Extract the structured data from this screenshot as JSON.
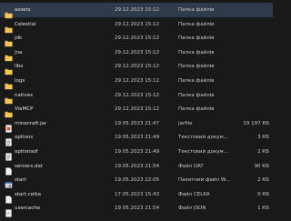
{
  "files": [
    {
      "name": "assets",
      "date": "29.12.2023 15:12",
      "type": "Папка файлів",
      "size": "",
      "icon": "folder-icon"
    },
    {
      "name": "Celestial",
      "date": "29.12.2023 15:12",
      "type": "Папка файлів",
      "size": "",
      "icon": "folder-icon"
    },
    {
      "name": "jdk",
      "date": "29.12.2023 15:12",
      "type": "Папка файлів",
      "size": "",
      "icon": "folder-icon"
    },
    {
      "name": "jna",
      "date": "29.12.2023 15:12",
      "type": "Папка файлів",
      "size": "",
      "icon": "folder-icon"
    },
    {
      "name": "libs",
      "date": "29.12.2023 15:12",
      "type": "Папка файлів",
      "size": "",
      "icon": "folder-icon"
    },
    {
      "name": "logs",
      "date": "29.12.2023 15:12",
      "type": "Папка файлів",
      "size": "",
      "icon": "folder-icon"
    },
    {
      "name": "natives",
      "date": "29.12.2023 15:12",
      "type": "Папка файлів",
      "size": "",
      "icon": "folder-icon"
    },
    {
      "name": "ViaMCP",
      "date": "29.12.2023 15:12",
      "type": "Папка файлів",
      "size": "",
      "icon": "folder-icon"
    },
    {
      "name": "minecraft.jar",
      "date": "19.05.2023 21:47",
      "type": "jarfile",
      "size": "19 197 КБ",
      "icon": "jar-file-icon"
    },
    {
      "name": "options",
      "date": "19.05.2023 21:49",
      "type": "Текстовий докум...",
      "size": "3 КБ",
      "icon": "text-file-icon"
    },
    {
      "name": "optionsof",
      "date": "19.05.2023 21:49",
      "type": "Текстовий докум...",
      "size": "2 КБ",
      "icon": "text-file-icon"
    },
    {
      "name": "servers.dat",
      "date": "19.05.2023 21:54",
      "type": "Файл DAT",
      "size": "90 КБ",
      "icon": "dat-file-icon"
    },
    {
      "name": "start",
      "date": "19.05.2023 22:05",
      "type": "Пакетний файл W...",
      "size": "2 КБ",
      "icon": "batch-file-icon"
    },
    {
      "name": "start.celka",
      "date": "17.05.2023 15:43",
      "type": "Файл CELKA",
      "size": "0 КБ",
      "icon": "file-icon"
    },
    {
      "name": "usercache",
      "date": "19.05.2023 21:54",
      "type": "Файл JSON",
      "size": "1 КБ",
      "icon": "json-file-icon"
    }
  ],
  "selected_index": 0,
  "colors": {
    "folder": "#e8b43a",
    "selection": "#2f3a4a",
    "background": "#191919"
  }
}
